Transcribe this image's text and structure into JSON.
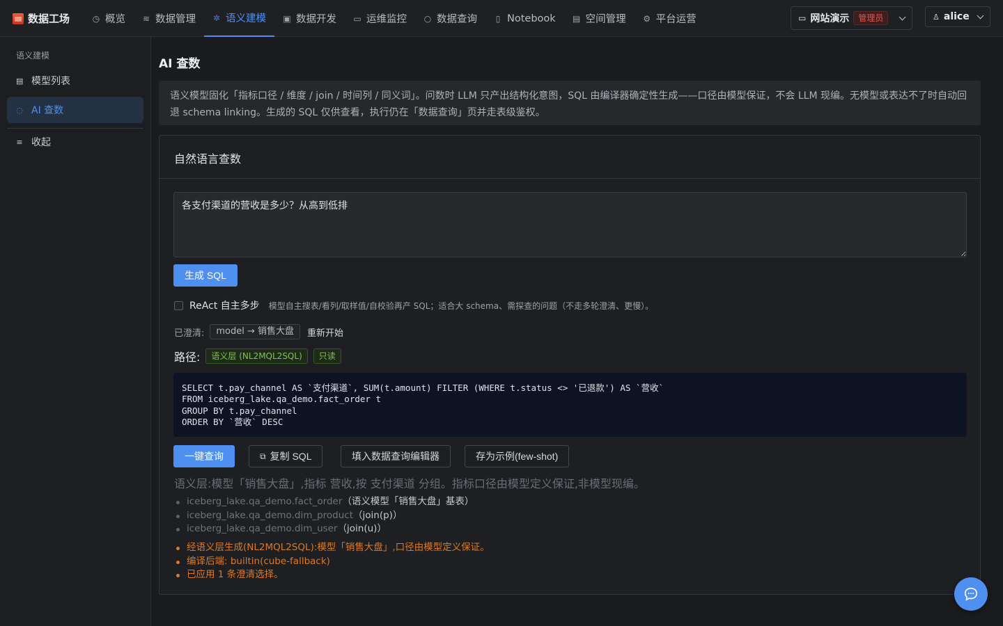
{
  "brand": {
    "title": "数据工场"
  },
  "nav": {
    "items": [
      {
        "label": "概览",
        "icon": "dashboard-icon"
      },
      {
        "label": "数据管理",
        "icon": "database-icon"
      },
      {
        "label": "语义建模",
        "icon": "semantic-icon",
        "active": true
      },
      {
        "label": "数据开发",
        "icon": "code-icon"
      },
      {
        "label": "运维监控",
        "icon": "monitor-icon"
      },
      {
        "label": "数据查询",
        "icon": "search-icon"
      },
      {
        "label": "Notebook",
        "icon": "notebook-icon"
      },
      {
        "label": "空间管理",
        "icon": "building-icon"
      },
      {
        "label": "平台运营",
        "icon": "gear-icon"
      }
    ]
  },
  "workspace": {
    "name": "网站演示",
    "role_badge": "管理员"
  },
  "user": {
    "name": "alice"
  },
  "sidebar": {
    "section_title": "语义建模",
    "items": [
      {
        "label": "模型列表"
      },
      {
        "label": "AI 查数",
        "active": true
      }
    ],
    "collapse_label": "收起"
  },
  "main": {
    "title": "AI 查数",
    "notice": "语义模型固化「指标口径 / 维度 / join / 时间列 / 同义词」。问数时 LLM 只产出结构化意图，SQL 由编译器确定性生成——口径由模型保证，不会 LLM 现编。无模型或表达不了时自动回退 schema linking。生成的 SQL 仅供查看，执行仍在「数据查询」页并走表级鉴权。",
    "card_title": "自然语言查数",
    "question": "各支付渠道的营收是多少？从高到低排",
    "generate_label": "生成 SQL",
    "react_label": "ReAct 自主多步",
    "react_desc": "模型自主搜表/看列/取样值/自校验再产 SQL；适合大 schema、需探查的问题（不走多轮澄清、更慢）。",
    "clarified_label": "已澄清:",
    "clarified_tag": "model → 销售大盘",
    "restart_label": "重新开始",
    "path_label": "路径:",
    "path_tags": [
      "语义层 (NL2MQL2SQL)",
      "只读"
    ],
    "sql": "SELECT t.pay_channel AS `支付渠道`, SUM(t.amount) FILTER (WHERE t.status <> '已退款') AS `营收`\nFROM iceberg_lake.qa_demo.fact_order t\nGROUP BY t.pay_channel\nORDER BY `营收` DESC",
    "actions": {
      "run": "一键查询",
      "copy": "复制 SQL",
      "fill": "填入数据查询编辑器",
      "save": "存为示例(few-shot)"
    },
    "semantic_summary": "语义层:模型「销售大盘」,指标 营收,按 支付渠道 分组。指标口径由模型定义保证,非模型现编。",
    "tables": [
      {
        "name": "iceberg_lake.qa_demo.fact_order",
        "note": "（语义模型「销售大盘」基表）"
      },
      {
        "name": "iceberg_lake.qa_demo.dim_product",
        "note": "（join(p)）"
      },
      {
        "name": "iceberg_lake.qa_demo.dim_user",
        "note": "（join(u)）"
      }
    ],
    "notes": [
      "经语义层生成(NL2MQL2SQL):模型「销售大盘」,口径由模型定义保证。",
      "编译后端: builtin(cube-fallback)",
      "已应用 1 条澄清选择。"
    ]
  },
  "colors": {
    "accent": "#4f8ff0",
    "warning": "#d97a2b",
    "success": "#7fc44f",
    "danger": "#e45555"
  }
}
